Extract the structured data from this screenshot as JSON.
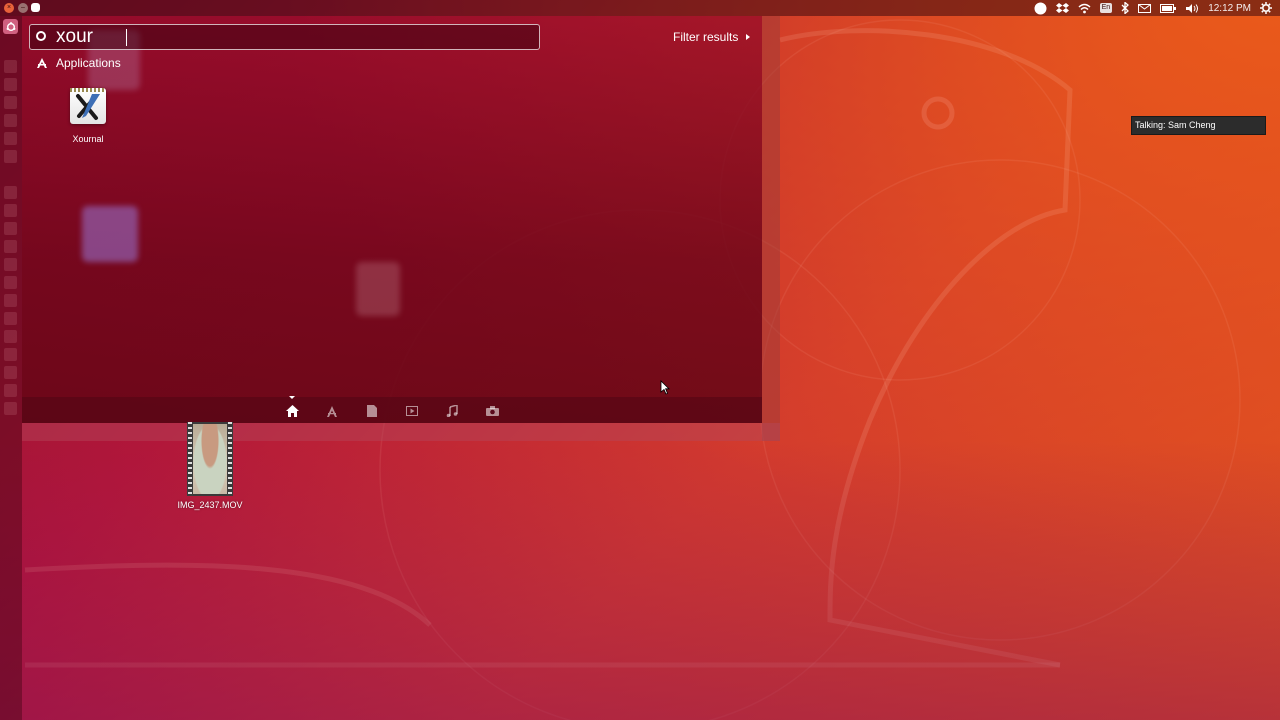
{
  "top_panel": {
    "clock": "12:12 PM",
    "keyboard_layout": "En",
    "icons": [
      "record-icon",
      "dropbox-icon",
      "wifi-icon",
      "keyboard-icon",
      "bluetooth-icon",
      "mail-icon",
      "battery-icon",
      "volume-icon",
      "power-gear-icon"
    ],
    "window_controls": [
      "close-icon",
      "minimize-icon",
      "maximize-icon"
    ]
  },
  "dash": {
    "search": {
      "value": "xour",
      "placeholder": ""
    },
    "filter_label": "Filter results",
    "section_label": "Applications",
    "results": [
      {
        "label": "Xournal",
        "icon": "xournal-icon"
      }
    ],
    "scopes": [
      {
        "name": "home-scope",
        "icon": "home-icon",
        "active": true
      },
      {
        "name": "applications-scope",
        "icon": "applications-icon",
        "active": false
      },
      {
        "name": "files-scope",
        "icon": "file-icon",
        "active": false
      },
      {
        "name": "video-scope",
        "icon": "video-icon",
        "active": false
      },
      {
        "name": "music-scope",
        "icon": "music-icon",
        "active": false
      },
      {
        "name": "photos-scope",
        "icon": "camera-icon",
        "active": false
      }
    ]
  },
  "tooltip": {
    "text": "Talking: Sam Cheng"
  },
  "desktop": {
    "files": [
      {
        "label": "IMG_2437.MOV",
        "icon": "video-file-icon"
      }
    ]
  },
  "colors": {
    "wallpaper_orange": "#e2531e",
    "wallpaper_crimson": "#8a0f30",
    "tooltip_bg": "#2c2c2c"
  }
}
